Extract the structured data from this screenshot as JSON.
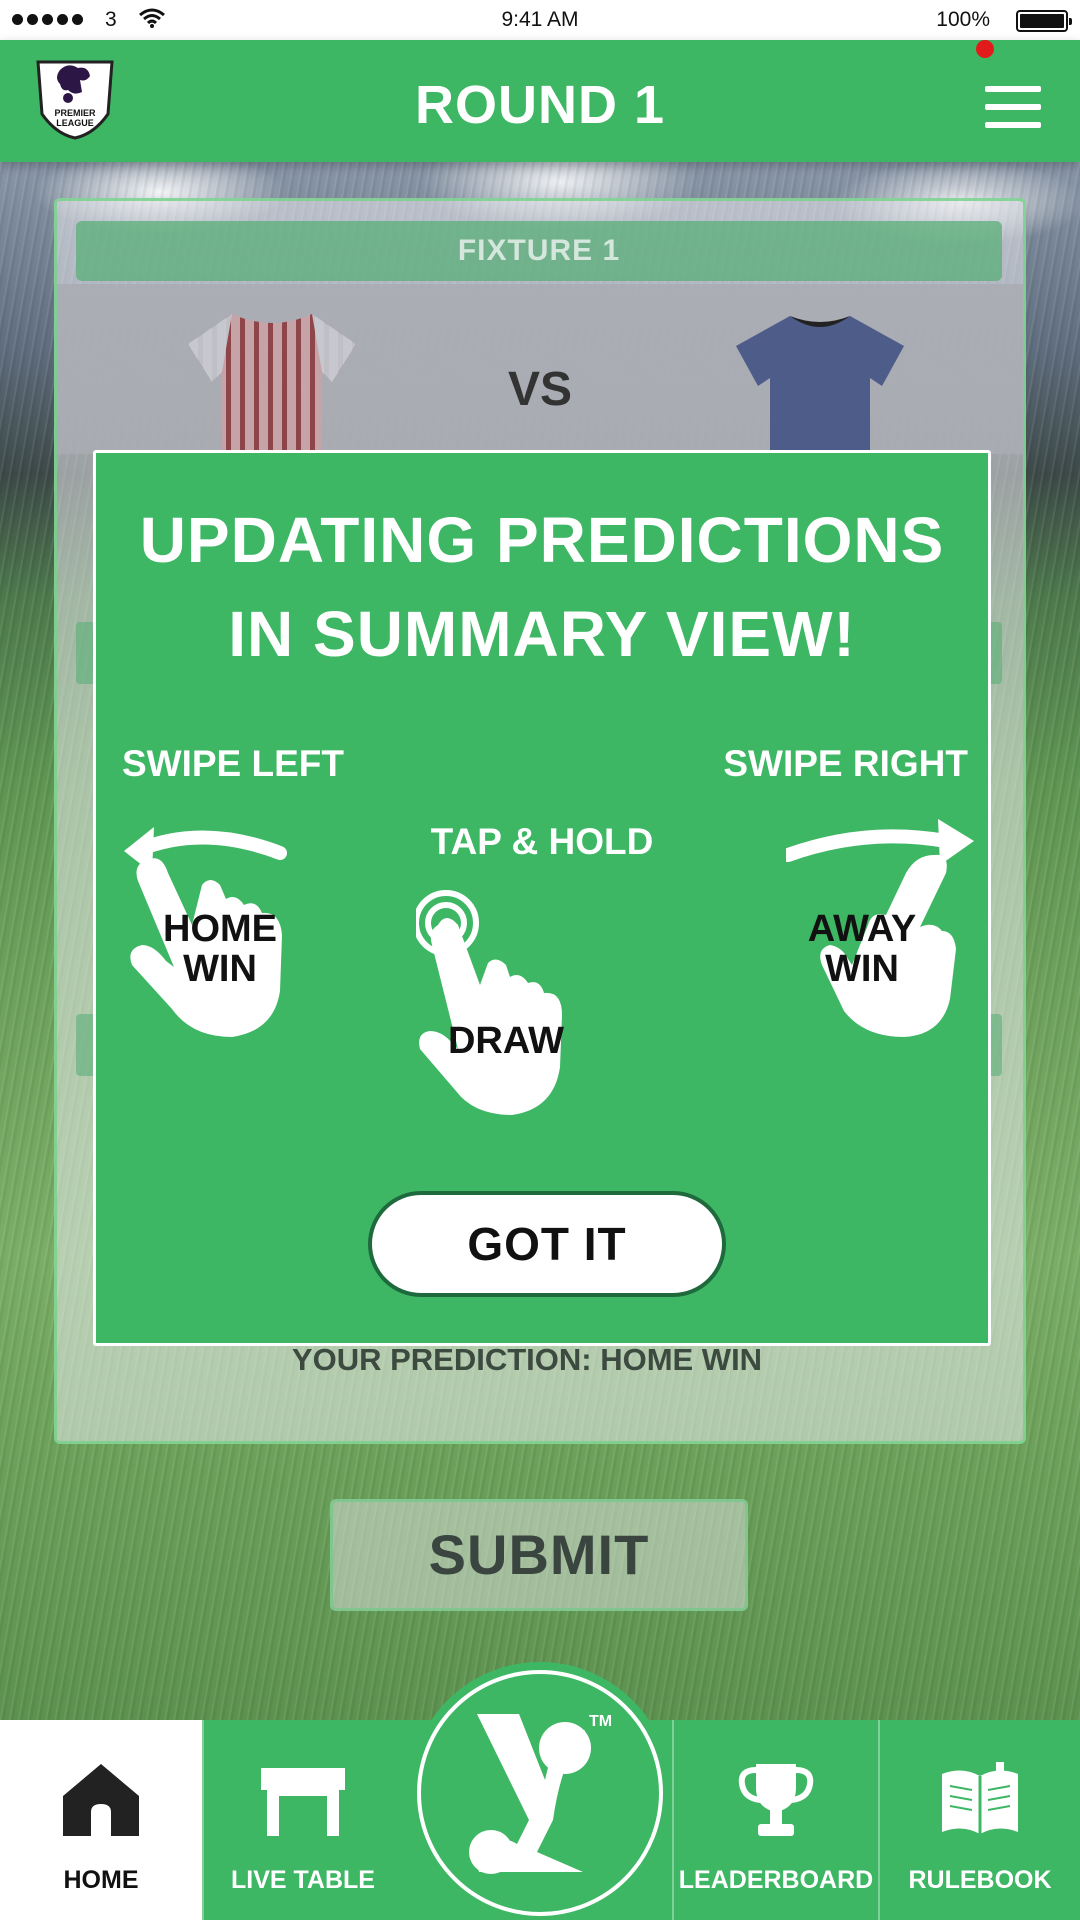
{
  "status_bar": {
    "carrier": "3",
    "time": "9:41 AM",
    "battery": "100%"
  },
  "header": {
    "title": "ROUND 1",
    "logo_text_line1": "PREMIER",
    "logo_text_line2": "LEAGUE"
  },
  "fixture": {
    "title": "FIXTURE 1",
    "vs": "VS",
    "your_prediction": "YOUR PREDICTION: HOME WIN",
    "home_shirt_color": "#8b3a3e",
    "away_shirt_color": "#2c3f80"
  },
  "submit_label": "SUBMIT",
  "overlay": {
    "title_line1": "UPDATING PREDICTIONS",
    "title_line2": "IN SUMMARY VIEW!",
    "swipe_left": "SWIPE LEFT",
    "swipe_right": "SWIPE RIGHT",
    "tap_hold": "TAP & HOLD",
    "home_win_line1": "HOME",
    "home_win_line2": "WIN",
    "draw": "DRAW",
    "away_win_line1": "AWAY",
    "away_win_line2": "WIN",
    "got_it": "GOT IT"
  },
  "tabs": {
    "home": "HOME",
    "live_table": "LIVE TABLE",
    "leaderboard": "LEADERBOARD",
    "rulebook": "RULEBOOK",
    "tm": "TM"
  },
  "colors": {
    "brand_green": "#3eb765",
    "dark_green": "#1f6a3d",
    "notification_red": "#e11b1b"
  }
}
